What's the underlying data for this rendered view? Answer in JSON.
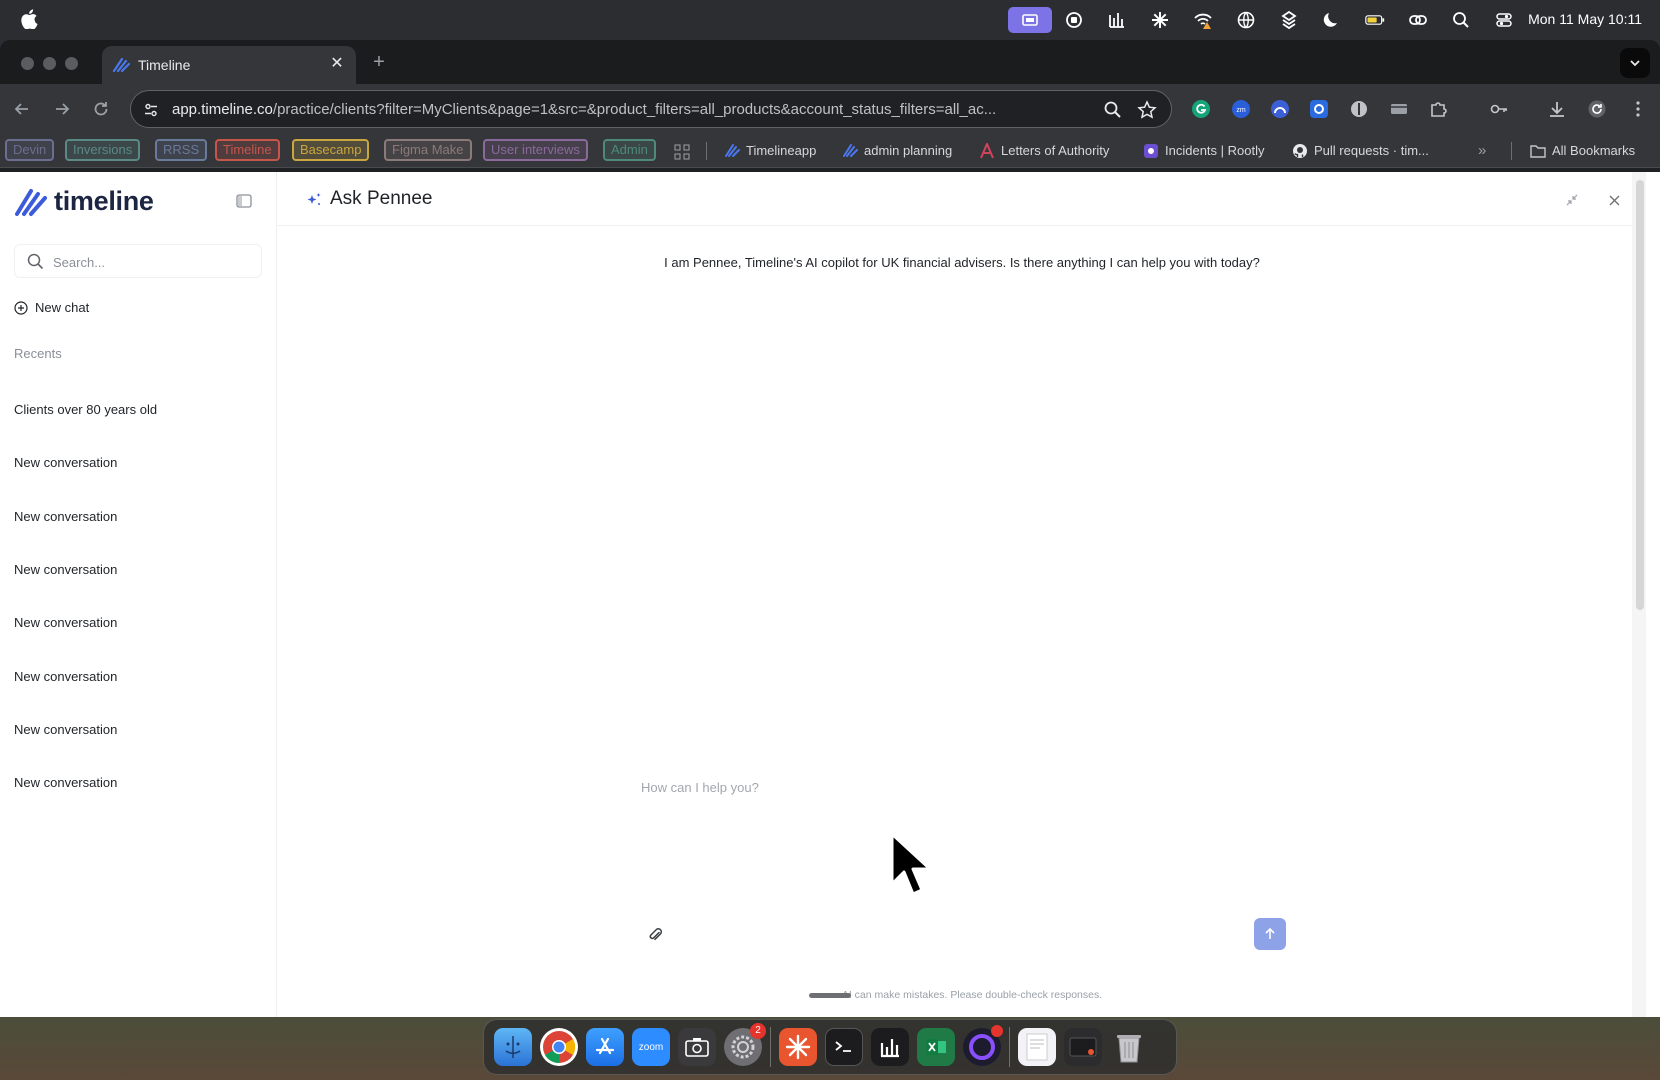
{
  "menubar": {
    "clock": "Mon 11 May  10:11"
  },
  "browser": {
    "tab_title": "Timeline",
    "url_host": "app.timeline.co",
    "url_path": "/practice/clients?filter=MyClients&page=1&src=&product_filters=all_products&account_status_filters=all_ac...",
    "bookmark_tags": [
      {
        "label": "Devin",
        "color": "#6b6e8f"
      },
      {
        "label": "Inversions",
        "color": "#5b8a86"
      },
      {
        "label": "RRSS",
        "color": "#6a7a9a"
      },
      {
        "label": "Timeline",
        "color": "#c4564c"
      },
      {
        "label": "Basecamp",
        "color": "#c9a640"
      },
      {
        "label": "Figma Make",
        "color": "#8a7a7a"
      },
      {
        "label": "User interviews",
        "color": "#8a6a9a"
      },
      {
        "label": "Admin",
        "color": "#4f8a78"
      }
    ],
    "bookmark_links": [
      "Timelineapp",
      "admin planning",
      "Letters of Authority",
      "Incidents | Rootly",
      "Pull requests · tim..."
    ],
    "bookmarks_overflow": "»",
    "all_bookmarks": "All Bookmarks"
  },
  "sidebar": {
    "logo_text": "timeline",
    "search_placeholder": "Search...",
    "new_chat_label": "New chat",
    "recents_label": "Recents",
    "history": [
      "Clients over 80 years old",
      "New conversation",
      "New conversation",
      "New conversation",
      "New conversation",
      "New conversation",
      "New conversation",
      "New conversation"
    ]
  },
  "chat": {
    "title": "Ask Pennee",
    "greeting": "I am Pennee, Timeline's AI copilot for UK financial advisers. Is there anything I can help you with today?",
    "input_placeholder": "How can I help you?",
    "disclaimer": "AI can make mistakes. Please double-check responses."
  },
  "dock": {
    "zoom_label": "zoom",
    "settings_badge": "2"
  },
  "colors": {
    "accent": "#8ea2e8",
    "brand": "#1c2541",
    "brand_blue": "#3b5bdb"
  }
}
